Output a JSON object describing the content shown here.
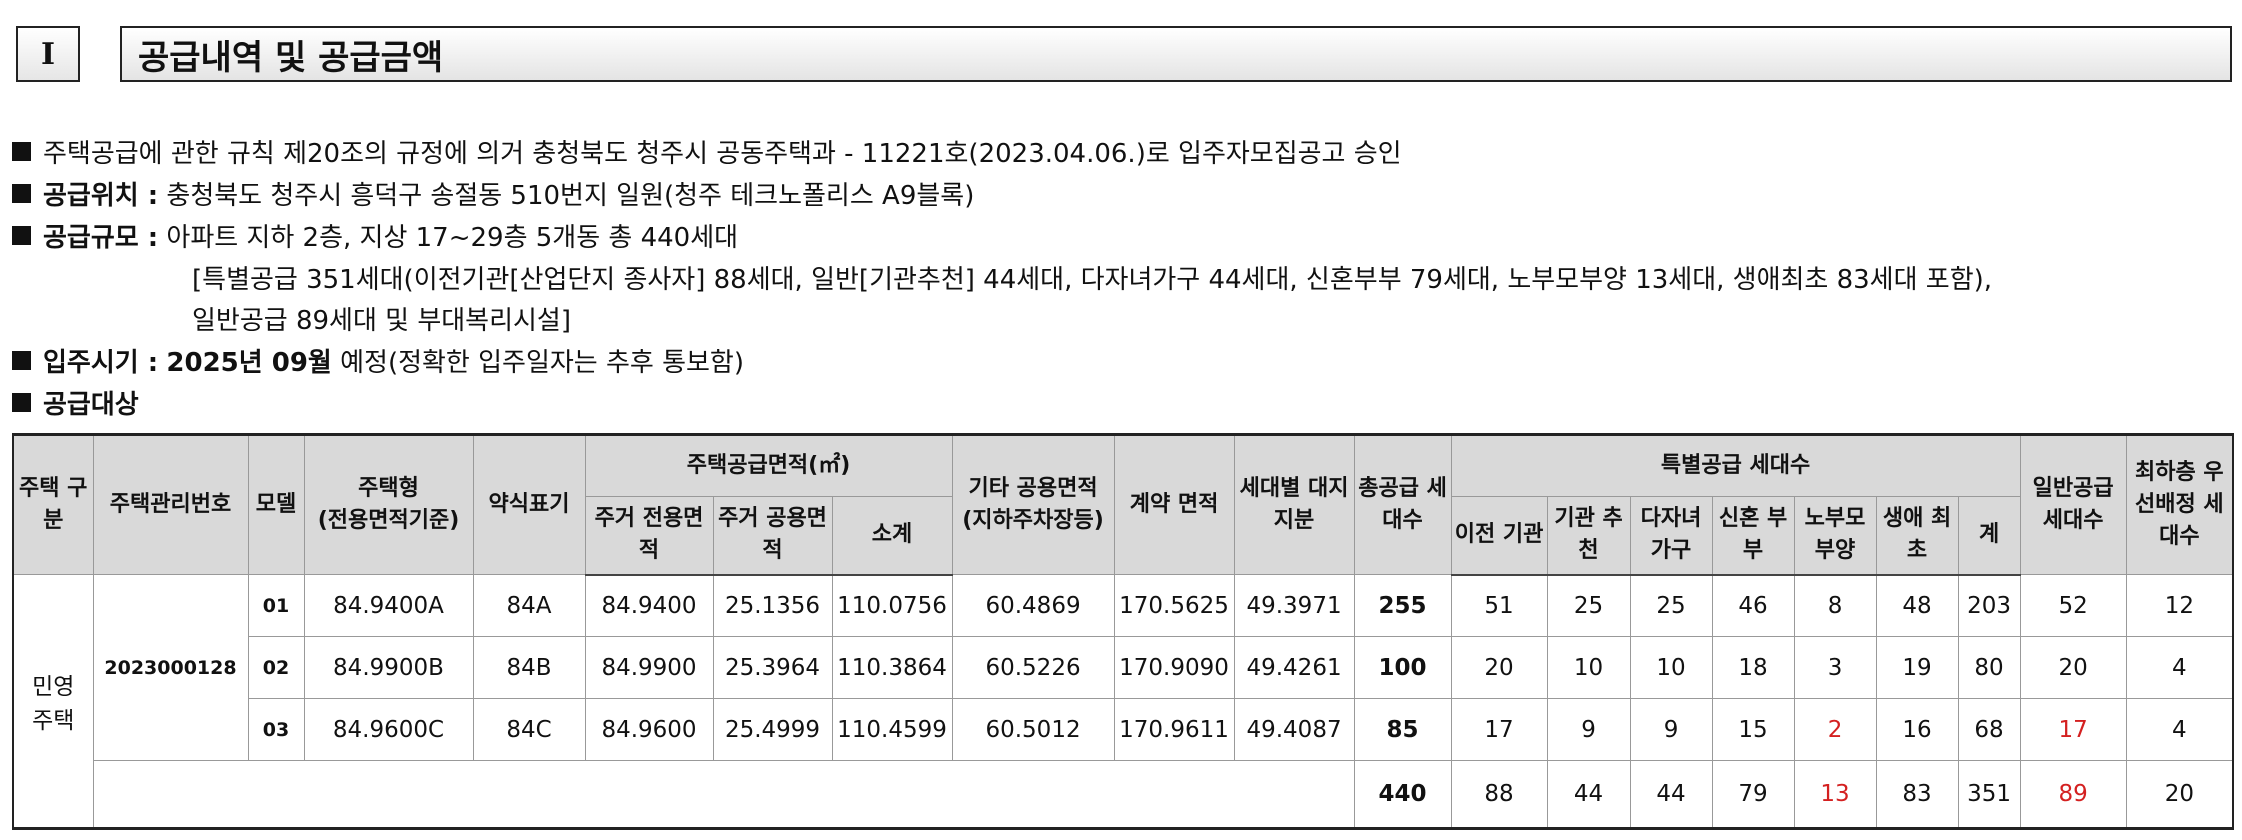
{
  "section": {
    "number": "I",
    "title": "공급내역 및 공급금액"
  },
  "bullets": {
    "approval": "주택공급에 관한 규칙 제20조의 규정에 의거 충청북도 청주시 공동주택과 - 11221호(2023.04.06.)로 입주자모집공고 승인",
    "location_label": "공급위치 :",
    "location_value": "충청북도 청주시 흥덕구 송절동 510번지 일원(청주 테크노폴리스 A9블록)",
    "scale_label": "공급규모 :",
    "scale_value": "아파트 지하 2층, 지상 17~29층 5개동 총 440세대",
    "scale_line2": "[특별공급 351세대(이전기관[산업단지 종사자] 88세대, 일반[기관추천] 44세대, 다자녀가구 44세대, 신혼부부 79세대, 노부모부양 13세대, 생애최초 83세대 포함),",
    "scale_line3": "일반공급 89세대 및 부대복리시설]",
    "move_label": "입주시기 :",
    "move_bold": "2025년 09월",
    "move_rest": "예정(정확한 입주일자는 추후 통보함)",
    "target_label": "공급대상"
  },
  "table": {
    "headers": {
      "house_type_class": "주택 구분",
      "mgmt_no": "주택관리번호",
      "model": "모델",
      "house_type": "주택형",
      "house_type_sub": "(전용면적기준)",
      "abbr": "약식표기",
      "supply_area": "주택공급면적(㎡)",
      "exclusive": "주거 전용면적",
      "common": "주거 공용면적",
      "subtotal": "소계",
      "other_common": "기타 공용면적",
      "other_common_sub": "(지하주차장등)",
      "contract_area": "계약 면적",
      "land_share": "세대별 대지지분",
      "total_supply": "총공급 세대수",
      "special": "특별공급 세대수",
      "sp_relocation": "이전 기관",
      "sp_agency": "기관 추천",
      "sp_multichild": "다자녀 가구",
      "sp_newlywed": "신혼 부부",
      "sp_parents": "노부모 부양",
      "sp_firsttime": "생애 최초",
      "sp_sum": "계",
      "general": "일반공급 세대수",
      "lowest_floor": "최하층 우선배정 세대수"
    },
    "house_class": "민영 주택",
    "mgmt_number": "2023000128",
    "rows": [
      {
        "model": "01",
        "type": "84.9400A",
        "abbr": "84A",
        "excl": "84.9400",
        "common": "25.1356",
        "sub": "110.0756",
        "other": "60.4869",
        "contract": "170.5625",
        "land": "49.3971",
        "total": "255",
        "reloc": "51",
        "agency": "25",
        "multi": "25",
        "newly": "46",
        "parents": "8",
        "first": "48",
        "spsum": "203",
        "general": "52",
        "lowest": "12"
      },
      {
        "model": "02",
        "type": "84.9900B",
        "abbr": "84B",
        "excl": "84.9900",
        "common": "25.3964",
        "sub": "110.3864",
        "other": "60.5226",
        "contract": "170.9090",
        "land": "49.4261",
        "total": "100",
        "reloc": "20",
        "agency": "10",
        "multi": "10",
        "newly": "18",
        "parents": "3",
        "first": "19",
        "spsum": "80",
        "general": "20",
        "lowest": "4"
      },
      {
        "model": "03",
        "type": "84.9600C",
        "abbr": "84C",
        "excl": "84.9600",
        "common": "25.4999",
        "sub": "110.4599",
        "other": "60.5012",
        "contract": "170.9611",
        "land": "49.4087",
        "total": "85",
        "reloc": "17",
        "agency": "9",
        "multi": "9",
        "newly": "15",
        "parents": "2",
        "first": "16",
        "spsum": "68",
        "general": "17",
        "lowest": "4"
      }
    ],
    "totals": {
      "total": "440",
      "reloc": "88",
      "agency": "44",
      "multi": "44",
      "newly": "79",
      "parents": "13",
      "first": "83",
      "spsum": "351",
      "general": "89",
      "lowest": "20"
    },
    "colors": {
      "highlight": "#d42020",
      "header_bg": "#d9d9d9"
    }
  }
}
